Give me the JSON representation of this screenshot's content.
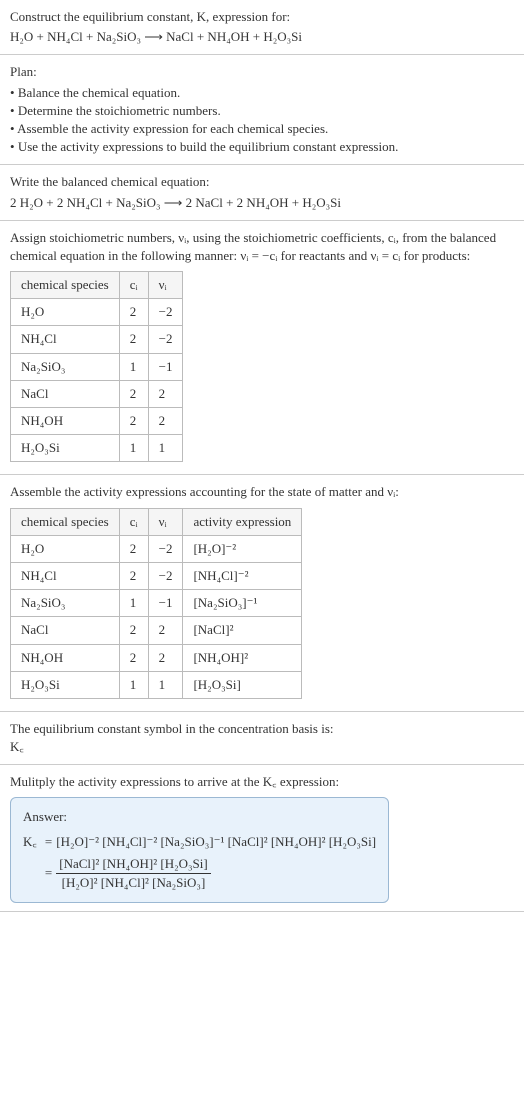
{
  "intro": {
    "line1": "Construct the equilibrium constant, K, expression for:",
    "equation": "H₂O + NH₄Cl + Na₂SiO₃ ⟶ NaCl + NH₄OH + H₂O₃Si"
  },
  "plan": {
    "title": "Plan:",
    "items": [
      "Balance the chemical equation.",
      "Determine the stoichiometric numbers.",
      "Assemble the activity expression for each chemical species.",
      "Use the activity expressions to build the equilibrium constant expression."
    ]
  },
  "balanced": {
    "title": "Write the balanced chemical equation:",
    "equation": "2 H₂O + 2 NH₄Cl + Na₂SiO₃ ⟶ 2 NaCl + 2 NH₄OH + H₂O₃Si"
  },
  "stoich": {
    "text": "Assign stoichiometric numbers, νᵢ, using the stoichiometric coefficients, cᵢ, from the balanced chemical equation in the following manner: νᵢ = −cᵢ for reactants and νᵢ = cᵢ for products:",
    "headers": [
      "chemical species",
      "cᵢ",
      "νᵢ"
    ],
    "rows": [
      {
        "species": "H₂O",
        "c": "2",
        "v": "−2"
      },
      {
        "species": "NH₄Cl",
        "c": "2",
        "v": "−2"
      },
      {
        "species": "Na₂SiO₃",
        "c": "1",
        "v": "−1"
      },
      {
        "species": "NaCl",
        "c": "2",
        "v": "2"
      },
      {
        "species": "NH₄OH",
        "c": "2",
        "v": "2"
      },
      {
        "species": "H₂O₃Si",
        "c": "1",
        "v": "1"
      }
    ]
  },
  "activity": {
    "text": "Assemble the activity expressions accounting for the state of matter and νᵢ:",
    "headers": [
      "chemical species",
      "cᵢ",
      "νᵢ",
      "activity expression"
    ],
    "rows": [
      {
        "species": "H₂O",
        "c": "2",
        "v": "−2",
        "expr": "[H₂O]⁻²"
      },
      {
        "species": "NH₄Cl",
        "c": "2",
        "v": "−2",
        "expr": "[NH₄Cl]⁻²"
      },
      {
        "species": "Na₂SiO₃",
        "c": "1",
        "v": "−1",
        "expr": "[Na₂SiO₃]⁻¹"
      },
      {
        "species": "NaCl",
        "c": "2",
        "v": "2",
        "expr": "[NaCl]²"
      },
      {
        "species": "NH₄OH",
        "c": "2",
        "v": "2",
        "expr": "[NH₄OH]²"
      },
      {
        "species": "H₂O₃Si",
        "c": "1",
        "v": "1",
        "expr": "[H₂O₃Si]"
      }
    ]
  },
  "symbol": {
    "text": "The equilibrium constant symbol in the concentration basis is:",
    "value": "K꜀"
  },
  "multiply": {
    "text": "Mulitply the activity expressions to arrive at the K꜀ expression:"
  },
  "answer": {
    "label": "Answer:",
    "lhs": "K꜀",
    "line1": "[H₂O]⁻² [NH₄Cl]⁻² [Na₂SiO₃]⁻¹ [NaCl]² [NH₄OH]² [H₂O₃Si]",
    "num": "[NaCl]² [NH₄OH]² [H₂O₃Si]",
    "den": "[H₂O]² [NH₄Cl]² [Na₂SiO₃]"
  },
  "chart_data": {
    "type": "table",
    "tables": [
      {
        "title": "Stoichiometric numbers",
        "headers": [
          "chemical species",
          "c_i",
          "nu_i"
        ],
        "rows": [
          [
            "H2O",
            2,
            -2
          ],
          [
            "NH4Cl",
            2,
            -2
          ],
          [
            "Na2SiO3",
            1,
            -1
          ],
          [
            "NaCl",
            2,
            2
          ],
          [
            "NH4OH",
            2,
            2
          ],
          [
            "H2O3Si",
            1,
            1
          ]
        ]
      },
      {
        "title": "Activity expressions",
        "headers": [
          "chemical species",
          "c_i",
          "nu_i",
          "activity expression"
        ],
        "rows": [
          [
            "H2O",
            2,
            -2,
            "[H2O]^-2"
          ],
          [
            "NH4Cl",
            2,
            -2,
            "[NH4Cl]^-2"
          ],
          [
            "Na2SiO3",
            1,
            -1,
            "[Na2SiO3]^-1"
          ],
          [
            "NaCl",
            2,
            2,
            "[NaCl]^2"
          ],
          [
            "NH4OH",
            2,
            2,
            "[NH4OH]^2"
          ],
          [
            "H2O3Si",
            1,
            1,
            "[H2O3Si]"
          ]
        ]
      }
    ]
  }
}
